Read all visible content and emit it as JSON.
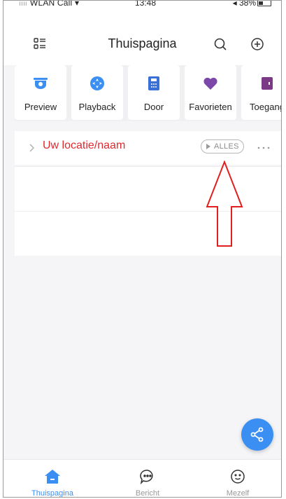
{
  "statusbar": {
    "carrier": "WLAN Call",
    "time": "13:48",
    "battery": "38%"
  },
  "header": {
    "title": "Thuispagina"
  },
  "quick_actions": [
    {
      "label": "Preview",
      "icon": "camera-icon"
    },
    {
      "label": "Playback",
      "icon": "playback-icon"
    },
    {
      "label": "Door",
      "icon": "door-icon"
    },
    {
      "label": "Favorieten",
      "icon": "heart-icon"
    },
    {
      "label": "Toegang",
      "icon": "access-icon"
    }
  ],
  "location": {
    "name": "Uw locatie/naam",
    "all_button": "ALLES"
  },
  "tabs": [
    {
      "label": "Thuispagina",
      "icon": "home-icon",
      "active": true
    },
    {
      "label": "Bericht",
      "icon": "message-icon",
      "active": false
    },
    {
      "label": "Mezelf",
      "icon": "profile-icon",
      "active": false
    }
  ],
  "colors": {
    "accent": "#3b8ff2",
    "location_text": "#e2282f",
    "annotation_arrow": "#e0201f"
  }
}
